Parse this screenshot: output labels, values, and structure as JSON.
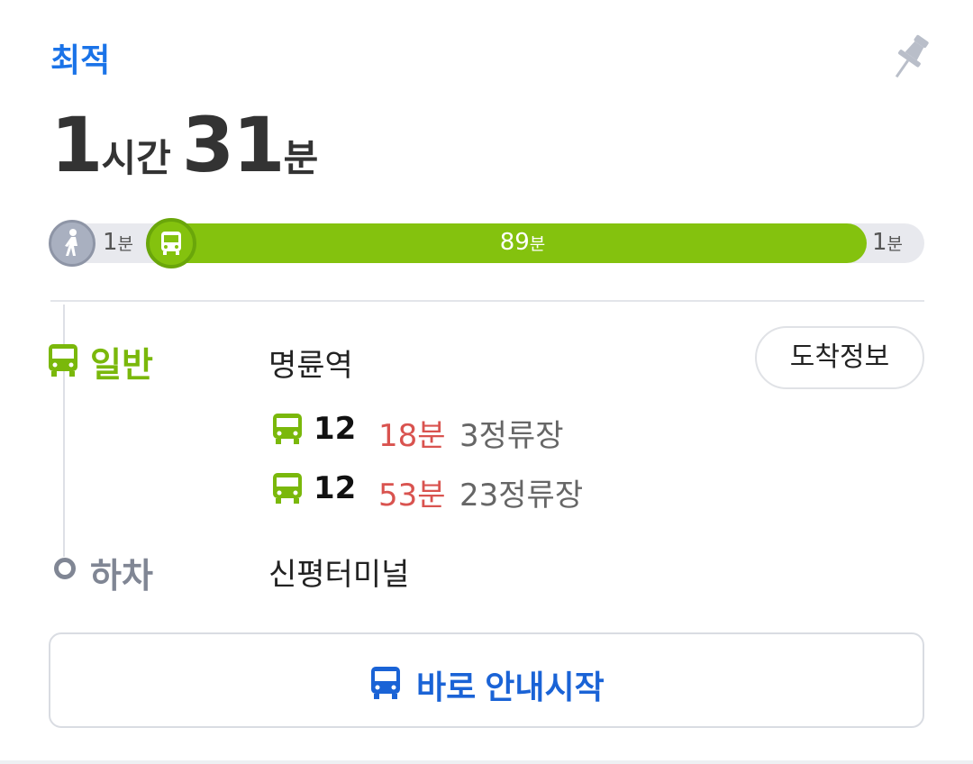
{
  "header": {
    "tag": "최적",
    "duration": {
      "hours": "1",
      "hours_unit": "시간",
      "minutes": "31",
      "minutes_unit": "분"
    }
  },
  "timeline": {
    "walk_start": {
      "value": "1",
      "unit": "분"
    },
    "bus": {
      "value": "89",
      "unit": "분"
    },
    "walk_end": {
      "value": "1",
      "unit": "분"
    }
  },
  "board": {
    "type": "일반",
    "station": "명륜역",
    "arrival_button": "도착정보",
    "buses": [
      {
        "number": "12",
        "eta": "18분",
        "stops": "3정류장"
      },
      {
        "number": "12",
        "eta": "53분",
        "stops": "23정류장"
      }
    ]
  },
  "alight": {
    "type": "하차",
    "station": "신평터미널"
  },
  "start_button": "바로 안내시작",
  "colors": {
    "accent_blue": "#1a73e8",
    "bus_green": "#84c20e",
    "eta_red": "#d9534f",
    "muted_gray": "#808694"
  },
  "icons": [
    "pin-icon",
    "walk-icon",
    "bus-icon"
  ]
}
